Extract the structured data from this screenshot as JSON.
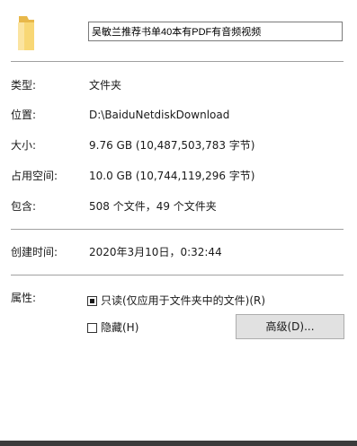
{
  "name_field": {
    "value": "吴敏兰推荐书单40本有PDF有音频视频"
  },
  "properties": {
    "type": {
      "label": "类型:",
      "value": "文件夹"
    },
    "location": {
      "label": "位置:",
      "value": "D:\\BaiduNetdiskDownload"
    },
    "size": {
      "label": "大小:",
      "value": "9.76 GB (10,487,503,783 字节)"
    },
    "size_on_disk": {
      "label": "占用空间:",
      "value": "10.0 GB (10,744,119,296 字节)"
    },
    "contains": {
      "label": "包含:",
      "value": "508 个文件，49 个文件夹"
    },
    "created": {
      "label": "创建时间:",
      "value": "2020年3月10日，0:32:44"
    }
  },
  "attributes": {
    "label": "属性:",
    "readonly": {
      "label": "只读(仅应用于文件夹中的文件)(R)",
      "state": "indeterminate"
    },
    "hidden": {
      "label": "隐藏(H)",
      "checked": false
    },
    "advanced_button": "高级(D)..."
  },
  "icons": {
    "folder": "folder-icon"
  },
  "colors": {
    "folder_yellow": "#f8d775",
    "folder_shade": "#e8b84a",
    "button_face": "#e1e1e1",
    "separator": "#a0a0a0"
  }
}
